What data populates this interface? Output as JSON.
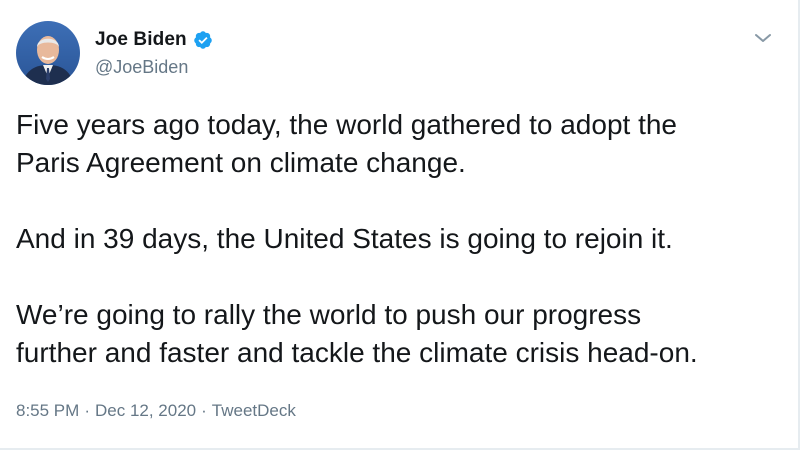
{
  "author": {
    "display_name": "Joe Biden",
    "handle": "@JoeBiden",
    "verified": true
  },
  "tweet": {
    "paragraphs": [
      "Five years ago today, the world gathered to adopt the\nParis Agreement on climate change.",
      "And in 39 days, the United States is going to rejoin it.",
      "We’re going to rally the world to push our progress\nfurther and faster and tackle the climate crisis head-on."
    ],
    "time": "8:55 PM",
    "separator": "·",
    "date": "Dec 12, 2020",
    "source": "TweetDeck"
  },
  "icons": {
    "verified": "verified-badge-icon",
    "menu": "chevron-down-icon"
  },
  "colors": {
    "text": "#14171a",
    "secondary": "#657786",
    "verified": "#1da1f2"
  }
}
